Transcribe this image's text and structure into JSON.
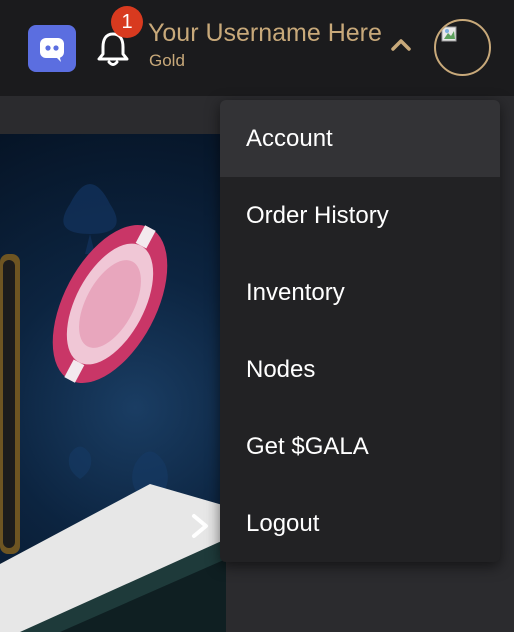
{
  "header": {
    "notification_count": "1",
    "username": "Your Username Here",
    "tier": "Gold"
  },
  "icons": {
    "discord": "discord-icon",
    "bell": "bell-icon",
    "chevron": "chevron-up-icon",
    "avatar": "broken-image-icon",
    "carousel_next": "chevron-right-icon"
  },
  "colors": {
    "accent_gold": "#c8a97a",
    "discord_blue": "#5b6ee0",
    "badge_red": "#d83a1f",
    "menu_bg": "#222224",
    "menu_active_bg": "#333336"
  },
  "dropdown": {
    "items": [
      {
        "label": "Account"
      },
      {
        "label": "Order History"
      },
      {
        "label": "Inventory"
      },
      {
        "label": "Nodes"
      },
      {
        "label": "Get $GALA"
      },
      {
        "label": "Logout"
      }
    ],
    "active_index": 0
  }
}
